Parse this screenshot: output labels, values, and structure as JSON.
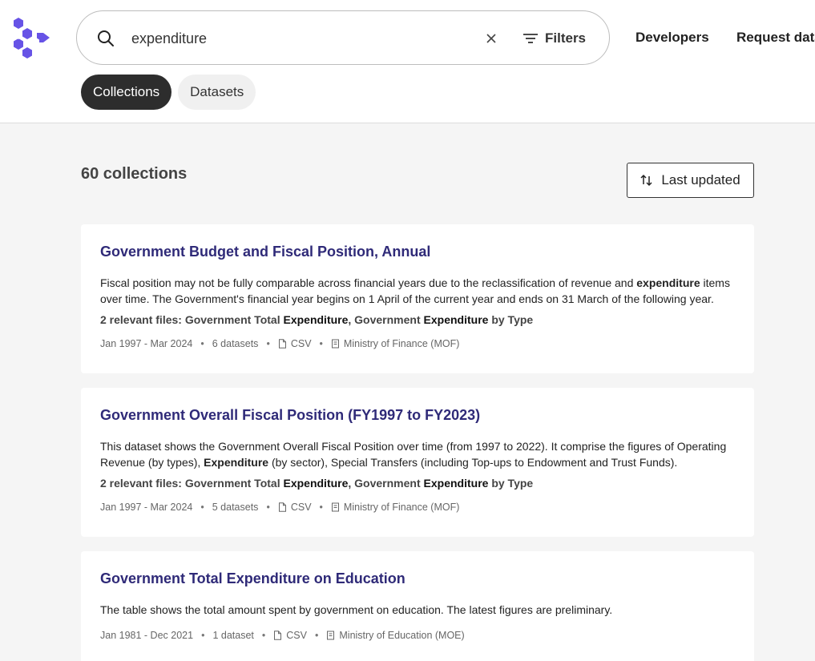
{
  "search": {
    "query": "expenditure"
  },
  "header": {
    "filters_label": "Filters",
    "nav": {
      "developers": "Developers",
      "request_data": "Request data"
    }
  },
  "tabs": [
    {
      "label": "Collections",
      "active": true
    },
    {
      "label": "Datasets",
      "active": false
    }
  ],
  "results": {
    "count_label": "60 collections",
    "sort_label": "Last updated"
  },
  "cards": [
    {
      "title": "Government Budget and Fiscal Position, Annual",
      "desc_a": "Fiscal position may not be fully comparable across financial years due to the reclassification of revenue and ",
      "desc_hl": "expenditure",
      "desc_b": " items over time.   The Government's financial year begins on 1 April of the current year and ends on 31 March of the following year.",
      "files_prefix": "2 relevant files: ",
      "file1_a": "Government Total ",
      "file1_hl": "Expenditure",
      "sep": ", ",
      "file2_a": "Government ",
      "file2_hl": "Expenditure",
      "file2_b": " by Type",
      "date_range": "Jan 1997 - Mar 2024",
      "datasets": "6 datasets",
      "format": "CSV",
      "agency": "Ministry of Finance (MOF)"
    },
    {
      "title": "Government Overall Fiscal Position (FY1997 to FY2023)",
      "desc_a": "This dataset shows the Government Overall Fiscal Position over time (from 1997 to 2022). It comprise the figures of Operating Revenue (by types), ",
      "desc_hl": "Expenditure",
      "desc_b": " (by sector), Special Transfers (including Top-ups to Endowment and Trust Funds).",
      "files_prefix": "2 relevant files: ",
      "file1_a": "Government Total ",
      "file1_hl": "Expenditure",
      "sep": ", ",
      "file2_a": "Government ",
      "file2_hl": "Expenditure",
      "file2_b": " by Type",
      "date_range": "Jan 1997 - Mar 2024",
      "datasets": "5 datasets",
      "format": "CSV",
      "agency": "Ministry of Finance (MOF)"
    },
    {
      "title": "Government Total Expenditure on Education",
      "desc": "The table shows the total amount spent by government on education. The latest figures are preliminary.",
      "date_range": "Jan 1981 - Dec 2021",
      "datasets": "1 dataset",
      "format": "CSV",
      "agency": "Ministry of Education (MOE)"
    }
  ],
  "colors": {
    "accent": "#6753e6",
    "title": "#2f2a78",
    "tab_active": "#2d2d2d"
  }
}
